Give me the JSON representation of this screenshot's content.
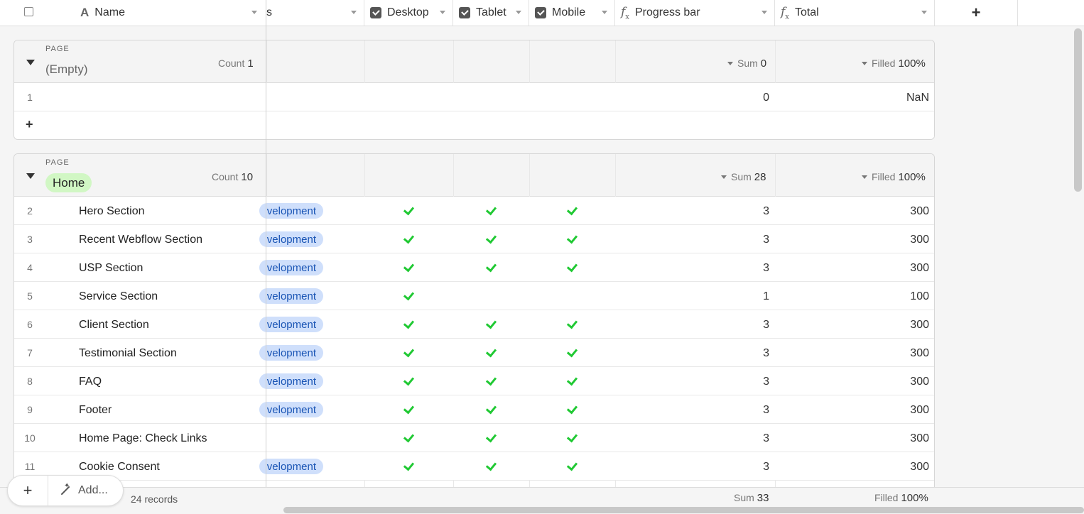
{
  "header": {
    "name_label": "Name",
    "status_partial": "s",
    "desktop_label": "Desktop",
    "tablet_label": "Tablet",
    "mobile_label": "Mobile",
    "progress_label": "Progress bar",
    "total_label": "Total",
    "add_column": "+"
  },
  "groups": [
    {
      "tag": "PAGE",
      "title": "(Empty)",
      "count_label": "Count",
      "count": "1",
      "sum_label": "Sum",
      "sum": "0",
      "filled_label": "Filled",
      "filled": "100%",
      "rows": [
        {
          "num": "1",
          "name": "",
          "status": "",
          "desktop": false,
          "tablet": false,
          "mobile": false,
          "progress": "0",
          "total": "NaN"
        }
      ]
    },
    {
      "tag": "PAGE",
      "title": "Home",
      "count_label": "Count",
      "count": "10",
      "sum_label": "Sum",
      "sum": "28",
      "filled_label": "Filled",
      "filled": "100%",
      "rows": [
        {
          "num": "2",
          "name": "Hero Section",
          "status": "velopment",
          "desktop": true,
          "tablet": true,
          "mobile": true,
          "progress": "3",
          "total": "300"
        },
        {
          "num": "3",
          "name": "Recent Webflow Section",
          "status": "velopment",
          "desktop": true,
          "tablet": true,
          "mobile": true,
          "progress": "3",
          "total": "300"
        },
        {
          "num": "4",
          "name": "USP Section",
          "status": "velopment",
          "desktop": true,
          "tablet": true,
          "mobile": true,
          "progress": "3",
          "total": "300"
        },
        {
          "num": "5",
          "name": "Service Section",
          "status": "velopment",
          "desktop": true,
          "tablet": false,
          "mobile": false,
          "progress": "1",
          "total": "100"
        },
        {
          "num": "6",
          "name": "Client Section",
          "status": "velopment",
          "desktop": true,
          "tablet": true,
          "mobile": true,
          "progress": "3",
          "total": "300"
        },
        {
          "num": "7",
          "name": "Testimonial Section",
          "status": "velopment",
          "desktop": true,
          "tablet": true,
          "mobile": true,
          "progress": "3",
          "total": "300"
        },
        {
          "num": "8",
          "name": "FAQ",
          "status": "velopment",
          "desktop": true,
          "tablet": true,
          "mobile": true,
          "progress": "3",
          "total": "300"
        },
        {
          "num": "9",
          "name": "Footer",
          "status": "velopment",
          "desktop": true,
          "tablet": true,
          "mobile": true,
          "progress": "3",
          "total": "300"
        },
        {
          "num": "10",
          "name": "Home Page: Check Links",
          "status": "",
          "desktop": true,
          "tablet": true,
          "mobile": true,
          "progress": "3",
          "total": "300"
        },
        {
          "num": "11",
          "name": "Cookie Consent",
          "status": "velopment",
          "desktop": true,
          "tablet": true,
          "mobile": true,
          "progress": "3",
          "total": "300"
        }
      ]
    }
  ],
  "footer": {
    "add_plus": "+",
    "add_label": "Add...",
    "records": "24 records",
    "sum_label": "Sum",
    "sum": "33",
    "filled_label": "Filled",
    "filled": "100%"
  },
  "icons": {
    "text_field": "text-field-icon",
    "checkbox_field": "checkbox-field-icon",
    "formula_field": "formula-icon",
    "magic_wand": "magic-wand-icon"
  },
  "colors": {
    "check_green": "#20c933",
    "status_pill_bg": "#cfdffb",
    "status_pill_text": "#1a55b5",
    "home_pill_bg": "#d1f7c4"
  }
}
